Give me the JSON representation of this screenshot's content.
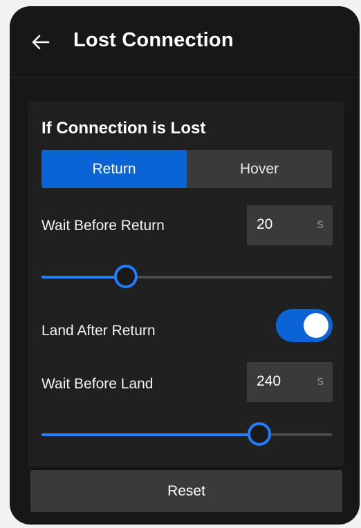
{
  "header": {
    "title": "Lost Connection",
    "back_icon": "back-arrow-icon"
  },
  "card": {
    "section_title": "If Connection is Lost",
    "action_options": [
      {
        "label": "Return",
        "selected": true
      },
      {
        "label": "Hover",
        "selected": false
      }
    ],
    "wait_before_return": {
      "label": "Wait Before Return",
      "value": "20",
      "unit": "s",
      "slider_level": 0.29
    },
    "land_after_return": {
      "label": "Land After Return",
      "enabled": true
    },
    "wait_before_land": {
      "label": "Wait Before Land",
      "value": "240",
      "unit": "s",
      "slider_level": 0.75
    }
  },
  "footer": {
    "reset_label": "Reset"
  },
  "colors": {
    "accent": "#1f7fff",
    "selected_segment": "#0a64d6",
    "panel_bg": "#171717",
    "card_bg": "#202020",
    "control_bg": "#3a3a3a"
  }
}
